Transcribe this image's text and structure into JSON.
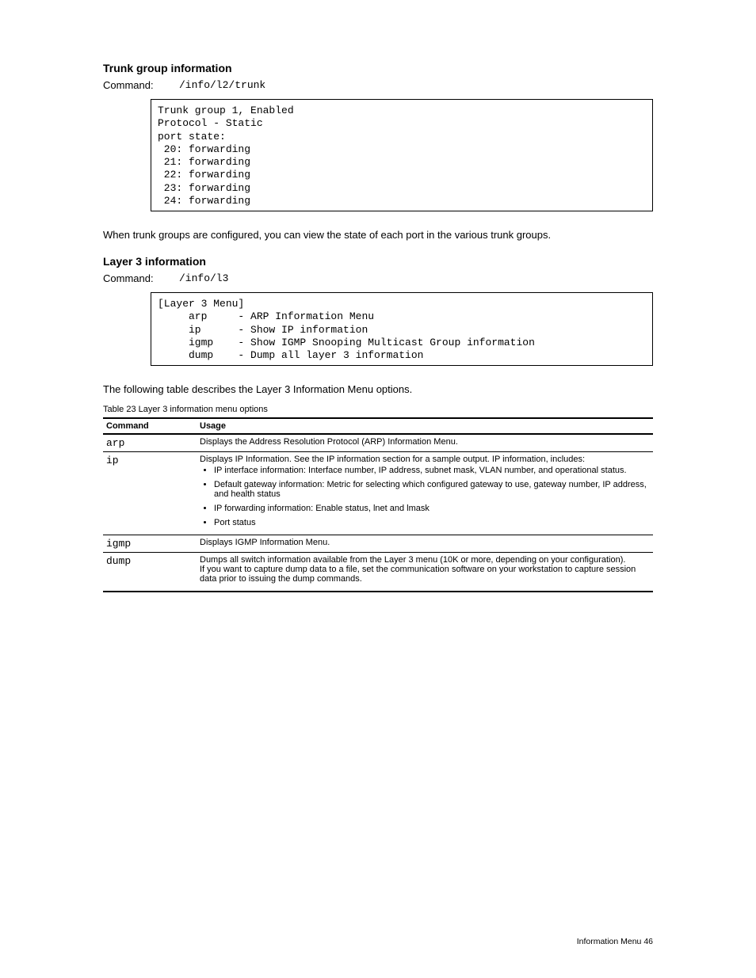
{
  "section1": {
    "title": "Trunk group information",
    "cmd_label": "Command:",
    "cmd_path": "/info/l2/trunk",
    "code": "Trunk group 1, Enabled\nProtocol - Static\nport state:\n 20: forwarding\n 21: forwarding\n 22: forwarding\n 23: forwarding\n 24: forwarding",
    "desc": "When trunk groups are configured, you can view the state of each port in the various trunk groups."
  },
  "section2": {
    "title": "Layer 3 information",
    "cmd_label": "Command:",
    "cmd_path": "/info/l3",
    "code": "[Layer 3 Menu]\n     arp     - ARP Information Menu\n     ip      - Show IP information\n     igmp    - Show IGMP Snooping Multicast Group information\n     dump    - Dump all layer 3 information",
    "desc": "The following table describes the Layer 3 Information Menu options."
  },
  "table": {
    "caption": "Table 23 Layer 3 information menu options",
    "head_left": "Command",
    "head_right": "Usage",
    "rows": [
      {
        "cmd": "arp",
        "usage": "Displays the Address Resolution Protocol (ARP) Information Menu."
      },
      {
        "cmd": "ip",
        "usage_lead": "Displays IP Information. See the IP information section for a sample output. IP information, includes:",
        "bullets": [
          "IP interface information: Interface number, IP address, subnet mask, VLAN number, and operational status.",
          "Default gateway information: Metric for selecting which configured gateway to use, gateway number, IP address, and health status",
          "IP forwarding information: Enable status, lnet and lmask",
          "Port status"
        ]
      },
      {
        "cmd": "igmp",
        "usage": "Displays IGMP Information Menu."
      },
      {
        "cmd": "dump",
        "usage_lead": "Dumps all switch information available from the Layer 3 menu (10K or more, depending on your configuration).",
        "usage_tail": "If you want to capture dump data to a file, set the communication software on your workstation to capture session data prior to issuing the dump commands."
      }
    ]
  },
  "footer": {
    "left": "",
    "right": "Information Menu 46"
  }
}
